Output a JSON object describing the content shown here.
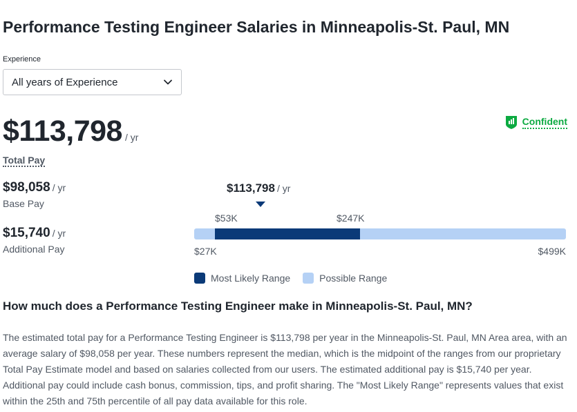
{
  "title": "Performance Testing Engineer Salaries in Minneapolis-St. Paul, MN",
  "experience": {
    "label": "Experience",
    "selected": "All years of Experience"
  },
  "confidence": {
    "label": "Confident",
    "icon": "bar-chart-shield-icon",
    "color": "#0caa41"
  },
  "total_pay": {
    "amount": "$113,798",
    "unit": "/ yr",
    "label": "Total Pay"
  },
  "base_pay": {
    "amount": "$98,058",
    "unit": "/ yr",
    "label": "Base Pay"
  },
  "additional_pay": {
    "amount": "$15,740",
    "unit": "/ yr",
    "label": "Additional Pay"
  },
  "range": {
    "median_label": "$113,798",
    "median_unit": "/ yr",
    "median_value": 113798,
    "likely_low_label": "$53K",
    "likely_high_label": "$247K",
    "likely_low": 53000,
    "likely_high": 247000,
    "possible_low_label": "$27K",
    "possible_high_label": "$499K",
    "possible_low": 27000,
    "possible_high": 499000,
    "likely_color": "#0b3a78",
    "possible_color": "#b5d1f5"
  },
  "legend": {
    "likely": "Most Likely Range",
    "possible": "Possible Range"
  },
  "question": "How much does a Performance Testing Engineer make in Minneapolis-St. Paul, MN?",
  "description": "The estimated total pay for a Performance Testing Engineer is $113,798 per year in the Minneapolis-St. Paul, MN Area area, with an average salary of $98,058 per year. These numbers represent the median, which is the midpoint of the ranges from our proprietary Total Pay Estimate model and based on salaries collected from our users. The estimated additional pay is $15,740 per year. Additional pay could include cash bonus, commission, tips, and profit sharing. The \"Most Likely Range\" represents values that exist within the 25th and 75th percentile of all pay data available for this role."
}
